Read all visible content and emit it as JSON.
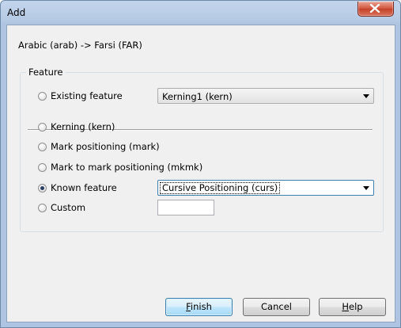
{
  "window": {
    "title": "Add"
  },
  "context_text": "Arabic (arab) -> Farsi (FAR)",
  "group": {
    "label": "Feature"
  },
  "options": {
    "existing": {
      "label": "Existing feature",
      "selected": false,
      "combo_value": "Kerning1 (kern)"
    },
    "kerning": {
      "label": "Kerning (kern)",
      "selected": false
    },
    "mark": {
      "label": "Mark positioning (mark)",
      "selected": false
    },
    "mkmk": {
      "label": "Mark to mark positioning (mkmk)",
      "selected": false
    },
    "known": {
      "label": "Known feature",
      "selected": true,
      "combo_value": "Cursive Positioning (curs)"
    },
    "custom": {
      "label": "Custom",
      "selected": false,
      "input_value": ""
    }
  },
  "buttons": {
    "finish": {
      "mnemonic": "F",
      "rest": "inish"
    },
    "cancel": {
      "label": "Cancel"
    },
    "help": {
      "mnemonic": "H",
      "rest": "elp"
    }
  }
}
